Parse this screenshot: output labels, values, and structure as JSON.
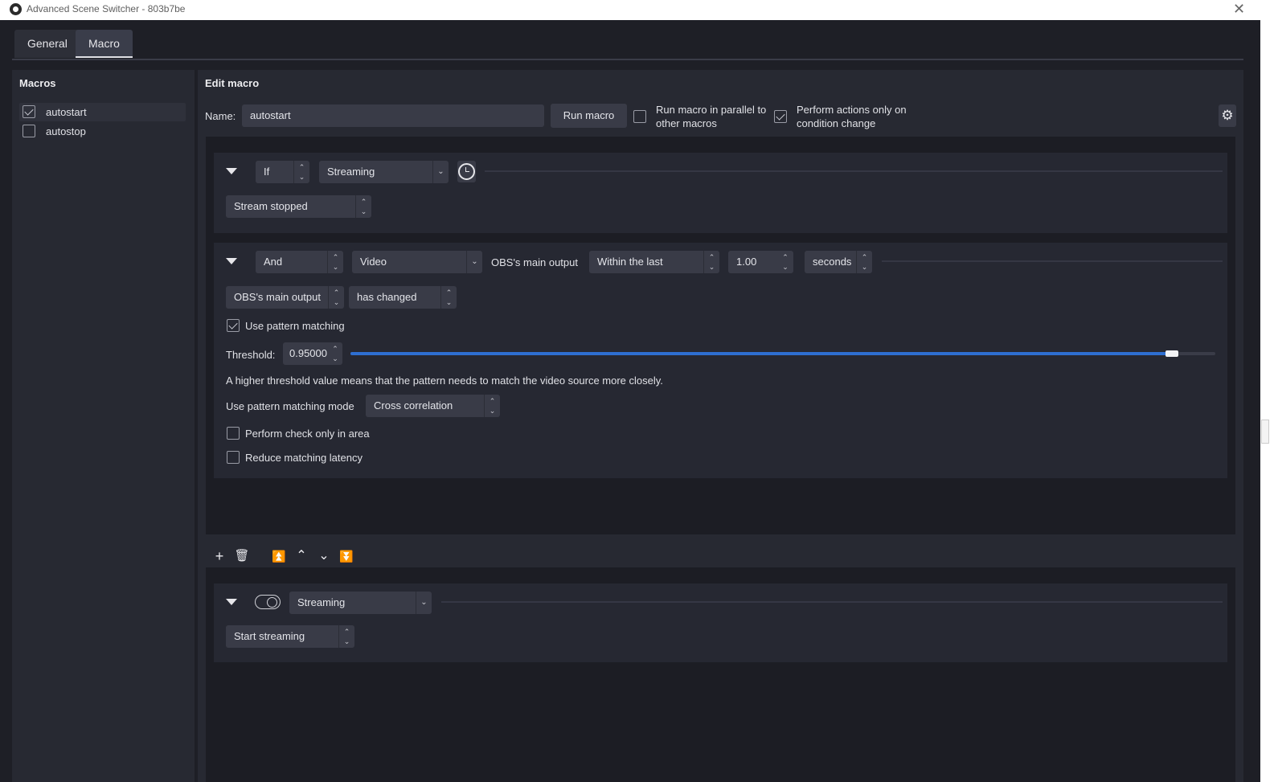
{
  "window": {
    "title": "Advanced Scene Switcher - 803b7be"
  },
  "tabs": [
    {
      "label": "General"
    },
    {
      "label": "Macro"
    }
  ],
  "macros": {
    "heading": "Macros",
    "items": [
      {
        "label": "autostart",
        "checked": true
      },
      {
        "label": "autostop",
        "checked": false
      }
    ]
  },
  "edit": {
    "heading": "Edit macro",
    "name_label": "Name:",
    "name_value": "autostart",
    "run_button": "Run macro",
    "parallel_line1": "Run macro in parallel to",
    "parallel_line2": "other macros",
    "only_change_line1": "Perform actions only on",
    "only_change_line2": "condition change"
  },
  "condition1": {
    "logic": "If",
    "type": "Streaming",
    "state": "Stream stopped"
  },
  "condition2": {
    "logic": "And",
    "type": "Video",
    "source_label": "OBS's main output",
    "duration_mode": "Within the last",
    "duration_value": "1.00",
    "duration_unit": "seconds",
    "source": "OBS's main output",
    "check": "has changed",
    "use_pattern": "Use pattern matching",
    "threshold_label": "Threshold:",
    "threshold_value": "0.95000",
    "threshold_level": 0.95,
    "help_text": "A higher threshold value means that the pattern needs to match the video source more closely.",
    "mode_label": "Use pattern matching mode",
    "mode_value": "Cross correlation",
    "area_check": "Perform check only in area",
    "latency_check": "Reduce matching latency"
  },
  "action1": {
    "type": "Streaming",
    "action": "Start streaming"
  }
}
